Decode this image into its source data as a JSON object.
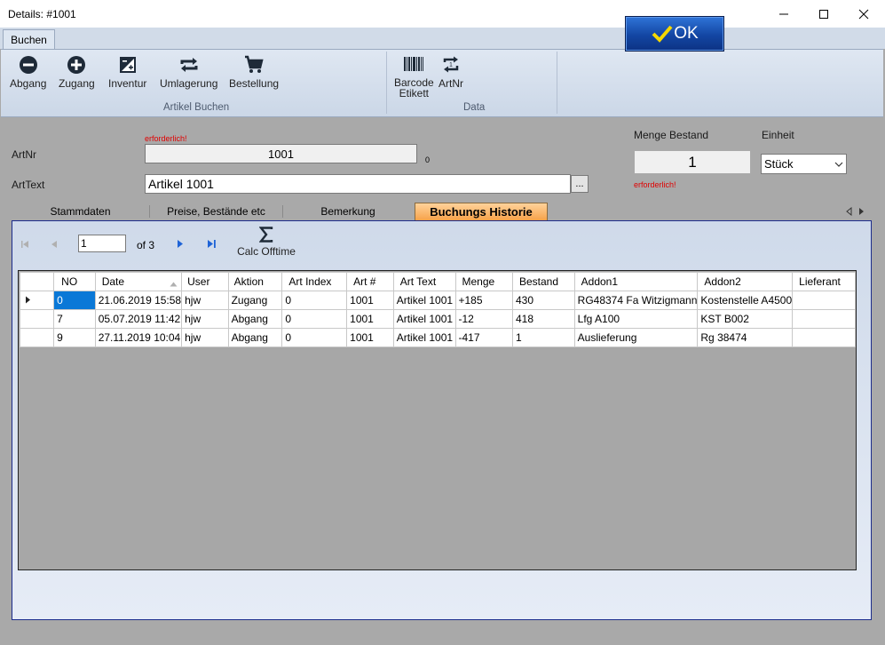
{
  "window": {
    "title": "Details: #1001"
  },
  "ribbon": {
    "tab_label": "Buchen",
    "buttons": [
      {
        "label": "Abgang",
        "icon": "minus-circle-icon"
      },
      {
        "label": "Zugang",
        "icon": "plus-circle-icon"
      },
      {
        "label": "Inventur",
        "icon": "inventory-icon"
      },
      {
        "label": "Umlagerung",
        "icon": "transfer-icon"
      },
      {
        "label": "Bestellung",
        "icon": "cart-icon"
      }
    ],
    "group1_label": "Artikel Buchen",
    "data_buttons": [
      {
        "label_line1": "Barcode",
        "label_line2": "Etikett",
        "icon": "barcode-icon"
      },
      {
        "label": "ArtNr",
        "icon": "swap-number-icon"
      }
    ],
    "group2_label": "Data",
    "ok_label": "OK"
  },
  "form": {
    "required_text": "erforderlich!",
    "artnr_label": "ArtNr",
    "artnr_value": "1001",
    "artnr_suffix": "0",
    "arttext_label": "ArtText",
    "arttext_value": "Artikel 1001",
    "browse_label": "...",
    "menge_label": "Menge Bestand",
    "menge_value": "1",
    "menge_required": "erforderlich!",
    "einheit_label": "Einheit",
    "einheit_value": "Stück"
  },
  "tabs": [
    "Stammdaten",
    "Preise, Bestände etc",
    "Bemerkung",
    "Buchungs Historie"
  ],
  "navigator": {
    "page_value": "1",
    "page_total": "of 3",
    "calc_label": "Calc Offtime"
  },
  "grid": {
    "columns": [
      "NO",
      "Date",
      "User",
      "Aktion",
      "Art Index",
      "Art #",
      "Art Text",
      "Menge",
      "Bestand",
      "Addon1",
      "Addon2",
      "Lieferant"
    ],
    "rows": [
      [
        "0",
        "21.06.2019 15:58",
        "hjw",
        "Zugang",
        "0",
        "1001",
        "Artikel 1001",
        "+185",
        "430",
        "RG48374 Fa Witzigmann",
        "Kostenstelle A4500",
        ""
      ],
      [
        "7",
        "05.07.2019 11:42",
        "hjw",
        "Abgang",
        "0",
        "1001",
        "Artikel 1001",
        "-12",
        "418",
        "Lfg A100",
        "KST B002",
        ""
      ],
      [
        "9",
        "27.11.2019 10:04",
        "hjw",
        "Abgang",
        "0",
        "1001",
        "Artikel 1001",
        "-417",
        "1",
        "Auslieferung",
        "Rg 38474",
        ""
      ]
    ]
  },
  "colors": {
    "accent_tab": "#f7a24a",
    "ok_button": "#1346a3",
    "selected_cell": "#0a78d7",
    "required": "#e00000"
  }
}
